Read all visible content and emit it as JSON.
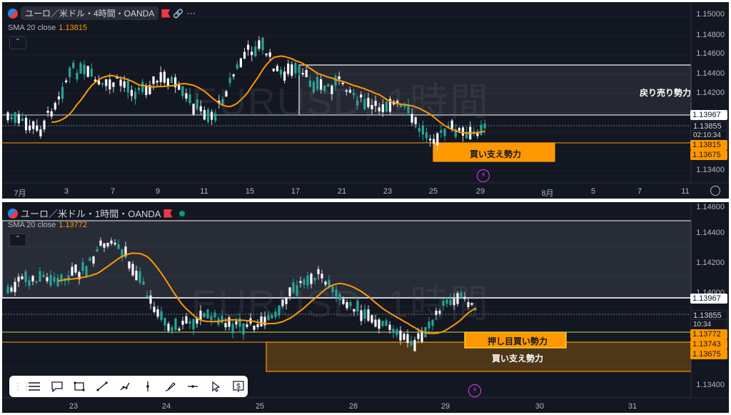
{
  "top_chart": {
    "symbol": "ユーロ／米ドル・4時間・OANDA",
    "indicator_label": "SMA 20 close",
    "indicator_value": "1.13815",
    "watermark": "EURUSD, 1時間",
    "price_labels": [
      "1.15000",
      "1.14800",
      "1.14600",
      "1.14400",
      "1.14200",
      "1.13400"
    ],
    "tags": {
      "resistance": "1.13967",
      "last": "1.13855",
      "countdown": "02:10:34",
      "sma": "1.13815",
      "support": "1.13675"
    },
    "time_labels": [
      "7月",
      "3",
      "7",
      "9",
      "11",
      "15",
      "17",
      "21",
      "23",
      "25",
      "29",
      "8月",
      "5",
      "7",
      "11"
    ],
    "annotations": {
      "resistance_zone": "戻り売り勢力",
      "support_zone": "買い支え勢力"
    }
  },
  "bottom_chart": {
    "symbol": "ユーロ／米ドル・1時間・OANDA",
    "indicator_label": "SMA 20 close",
    "indicator_value": "1.13772",
    "watermark": "EURUSD, 1時間",
    "price_labels": [
      "1.14600",
      "1.14400",
      "1.14200",
      "1.14000",
      "1.13400"
    ],
    "tags": {
      "resistance": "1.13967",
      "last": "1.13855",
      "countdown": "10:34",
      "sma": "1.13772",
      "dip_buy": "1.13743",
      "support": "1.13675"
    },
    "time_labels": [
      "23",
      "24",
      "25",
      "28",
      "29",
      "30",
      "31"
    ],
    "annotations": {
      "dip_buy_zone": "押し目買い勢力",
      "support_zone": "買い支え勢力"
    }
  },
  "toolbar": {
    "tools": [
      "horizontal-lines-icon",
      "callout-icon",
      "rectangle-icon",
      "trendline-icon",
      "path-icon",
      "vertical-line-icon",
      "brush-icon",
      "horizontal-ray-icon",
      "cursor-icon",
      "price-label-icon"
    ]
  },
  "colors": {
    "background": "#131722",
    "up": "#26a69a",
    "down": "#ffffff",
    "sma": "#ff9800",
    "zone_fill": "rgba(120,123,134,0.25)",
    "support_fill": "rgba(255,152,0,0.22)"
  }
}
